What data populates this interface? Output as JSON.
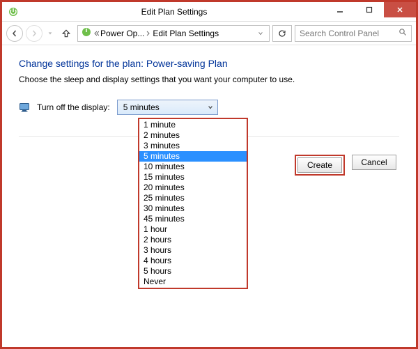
{
  "window": {
    "title": "Edit Plan Settings"
  },
  "address": {
    "crumb1": "Power Op...",
    "crumb2": "Edit Plan Settings"
  },
  "search": {
    "placeholder": "Search Control Panel"
  },
  "page": {
    "heading": "Change settings for the plan: Power-saving Plan",
    "desc": "Choose the sleep and display settings that you want your computer to use."
  },
  "setting": {
    "label": "Turn off the display:",
    "value": "5 minutes"
  },
  "options": [
    "1 minute",
    "2 minutes",
    "3 minutes",
    "5 minutes",
    "10 minutes",
    "15 minutes",
    "20 minutes",
    "25 minutes",
    "30 minutes",
    "45 minutes",
    "1 hour",
    "2 hours",
    "3 hours",
    "4 hours",
    "5 hours",
    "Never"
  ],
  "selected_option_index": 3,
  "buttons": {
    "create": "Create",
    "cancel": "Cancel"
  }
}
